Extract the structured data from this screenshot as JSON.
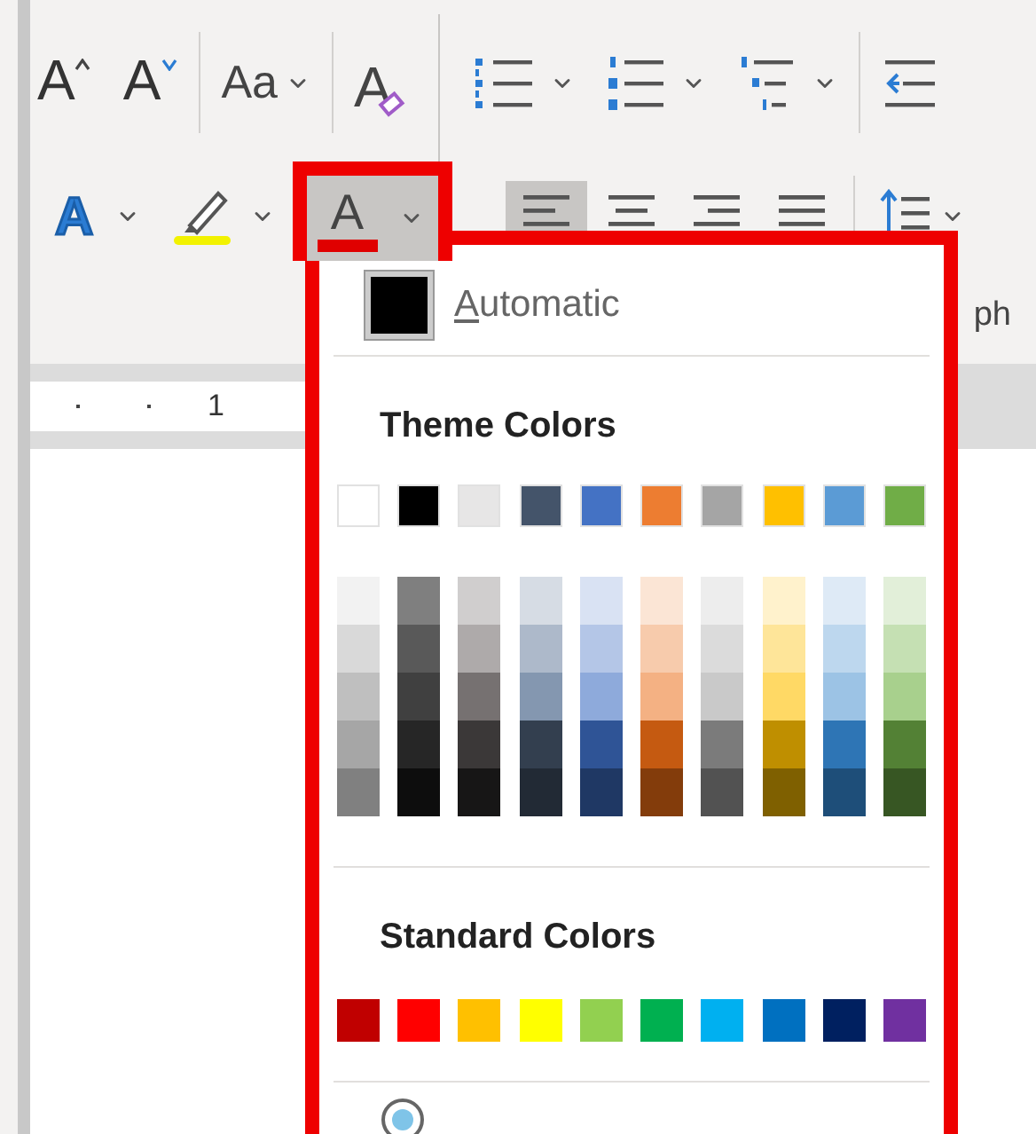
{
  "ribbon": {
    "row_1": [
      {
        "kind": "grow",
        "glyph": "A"
      },
      {
        "kind": "shrink",
        "glyph": "A"
      },
      {
        "kind": "case",
        "glyph": "Aa"
      },
      {
        "kind": "clear",
        "glyph": "A"
      },
      {
        "kind": "bullets"
      },
      {
        "kind": "numbering"
      },
      {
        "kind": "multilevel"
      },
      {
        "kind": "outdent"
      }
    ],
    "row_2": [
      {
        "kind": "effects",
        "glyph": "A"
      },
      {
        "kind": "highlight"
      },
      {
        "kind": "font-color",
        "glyph": "A",
        "open": true
      },
      {
        "kind": "align-left",
        "selected": true
      },
      {
        "kind": "align-center",
        "selected": false
      },
      {
        "kind": "align-right",
        "selected": false
      },
      {
        "kind": "justify",
        "selected": false
      },
      {
        "kind": "line-spacing"
      }
    ],
    "group_label": "ph"
  },
  "ruler": {
    "label": "1"
  },
  "font_color_menu": {
    "automatic": {
      "label": "Automatic",
      "access_key_underlined": true
    },
    "theme_heading": "Theme Colors",
    "theme_colors": [
      {
        "color": "#ffffff",
        "shades": [
          {
            "color": "#f2f2f2"
          },
          {
            "color": "#d9d9d9"
          },
          {
            "color": "#bfbfbf"
          },
          {
            "color": "#a6a6a6"
          },
          {
            "color": "#808080"
          }
        ]
      },
      {
        "color": "#000000",
        "shades": [
          {
            "color": "#7f7f7f"
          },
          {
            "color": "#595959"
          },
          {
            "color": "#404040"
          },
          {
            "color": "#262626"
          },
          {
            "color": "#0d0d0d"
          }
        ]
      },
      {
        "color": "#e7e6e6",
        "shades": [
          {
            "color": "#d0cece"
          },
          {
            "color": "#aeaaaa"
          },
          {
            "color": "#767171"
          },
          {
            "color": "#3b3838"
          },
          {
            "color": "#171616"
          }
        ]
      },
      {
        "color": "#44546a",
        "shades": [
          {
            "color": "#d6dce4"
          },
          {
            "color": "#adb9ca"
          },
          {
            "color": "#8497b0"
          },
          {
            "color": "#333f4f"
          },
          {
            "color": "#222a35"
          }
        ]
      },
      {
        "color": "#4472c4",
        "shades": [
          {
            "color": "#d9e2f3"
          },
          {
            "color": "#b4c6e7"
          },
          {
            "color": "#8eaadb"
          },
          {
            "color": "#2f5496"
          },
          {
            "color": "#1f3864"
          }
        ]
      },
      {
        "color": "#ed7d31",
        "shades": [
          {
            "color": "#fbe5d5"
          },
          {
            "color": "#f7cbac"
          },
          {
            "color": "#f4b183"
          },
          {
            "color": "#c55a11"
          },
          {
            "color": "#833c0b"
          }
        ]
      },
      {
        "color": "#a5a5a5",
        "shades": [
          {
            "color": "#ededed"
          },
          {
            "color": "#dbdbdb"
          },
          {
            "color": "#c9c9c9"
          },
          {
            "color": "#7b7b7b"
          },
          {
            "color": "#525252"
          }
        ]
      },
      {
        "color": "#ffc000",
        "shades": [
          {
            "color": "#fff2cc"
          },
          {
            "color": "#fee599"
          },
          {
            "color": "#ffd965"
          },
          {
            "color": "#bf8f00"
          },
          {
            "color": "#7f6000"
          }
        ]
      },
      {
        "color": "#5b9bd5",
        "shades": [
          {
            "color": "#deeaf6"
          },
          {
            "color": "#bdd7ee"
          },
          {
            "color": "#9cc3e5"
          },
          {
            "color": "#2e75b5"
          },
          {
            "color": "#1e4e79"
          }
        ]
      },
      {
        "color": "#70ad47",
        "shades": [
          {
            "color": "#e2efd9"
          },
          {
            "color": "#c5e0b3"
          },
          {
            "color": "#a8d08d"
          },
          {
            "color": "#538135"
          },
          {
            "color": "#375623"
          }
        ]
      }
    ],
    "standard_heading": "Standard Colors",
    "standard_colors": [
      {
        "color": "#c00000"
      },
      {
        "color": "#ff0000"
      },
      {
        "color": "#ffc000"
      },
      {
        "color": "#ffff00"
      },
      {
        "color": "#92d050"
      },
      {
        "color": "#00b050"
      },
      {
        "color": "#00b0f0"
      },
      {
        "color": "#0070c0"
      },
      {
        "color": "#002060"
      },
      {
        "color": "#7030a0"
      }
    ]
  }
}
